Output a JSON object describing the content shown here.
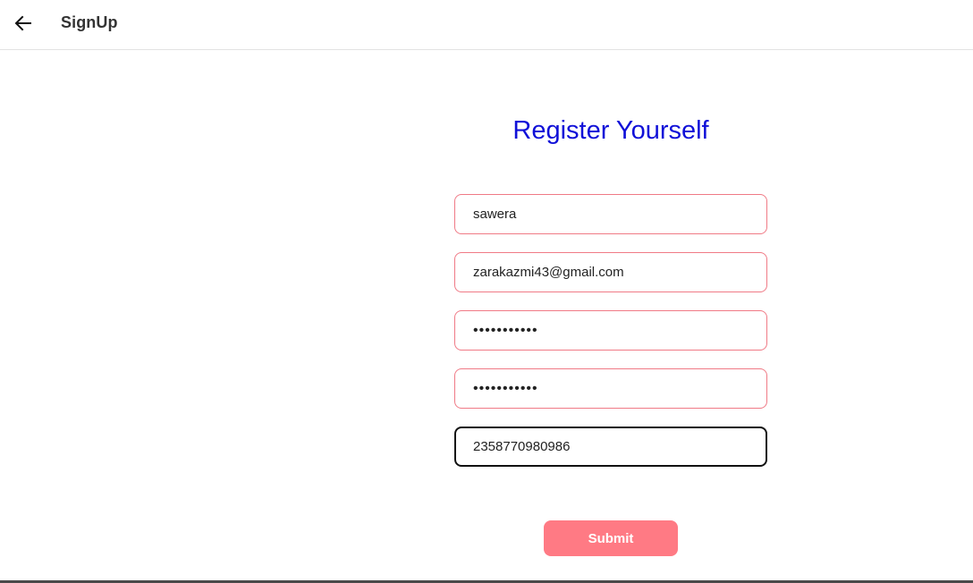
{
  "appbar": {
    "back_icon": "arrow-left-icon",
    "title": "SignUp"
  },
  "form": {
    "heading": "Register Yourself",
    "fields": [
      {
        "value": "sawera",
        "type": "text"
      },
      {
        "value": "zarakazmi43@gmail.com",
        "type": "email"
      },
      {
        "value": "password123",
        "type": "password"
      },
      {
        "value": "password123",
        "type": "password"
      },
      {
        "value": "2358770980986",
        "type": "tel",
        "focused": true
      }
    ],
    "submit_label": "Submit"
  },
  "colors": {
    "heading": "#1010d8",
    "field_border": "#f07a86",
    "submit_bg": "#ff7a84"
  }
}
